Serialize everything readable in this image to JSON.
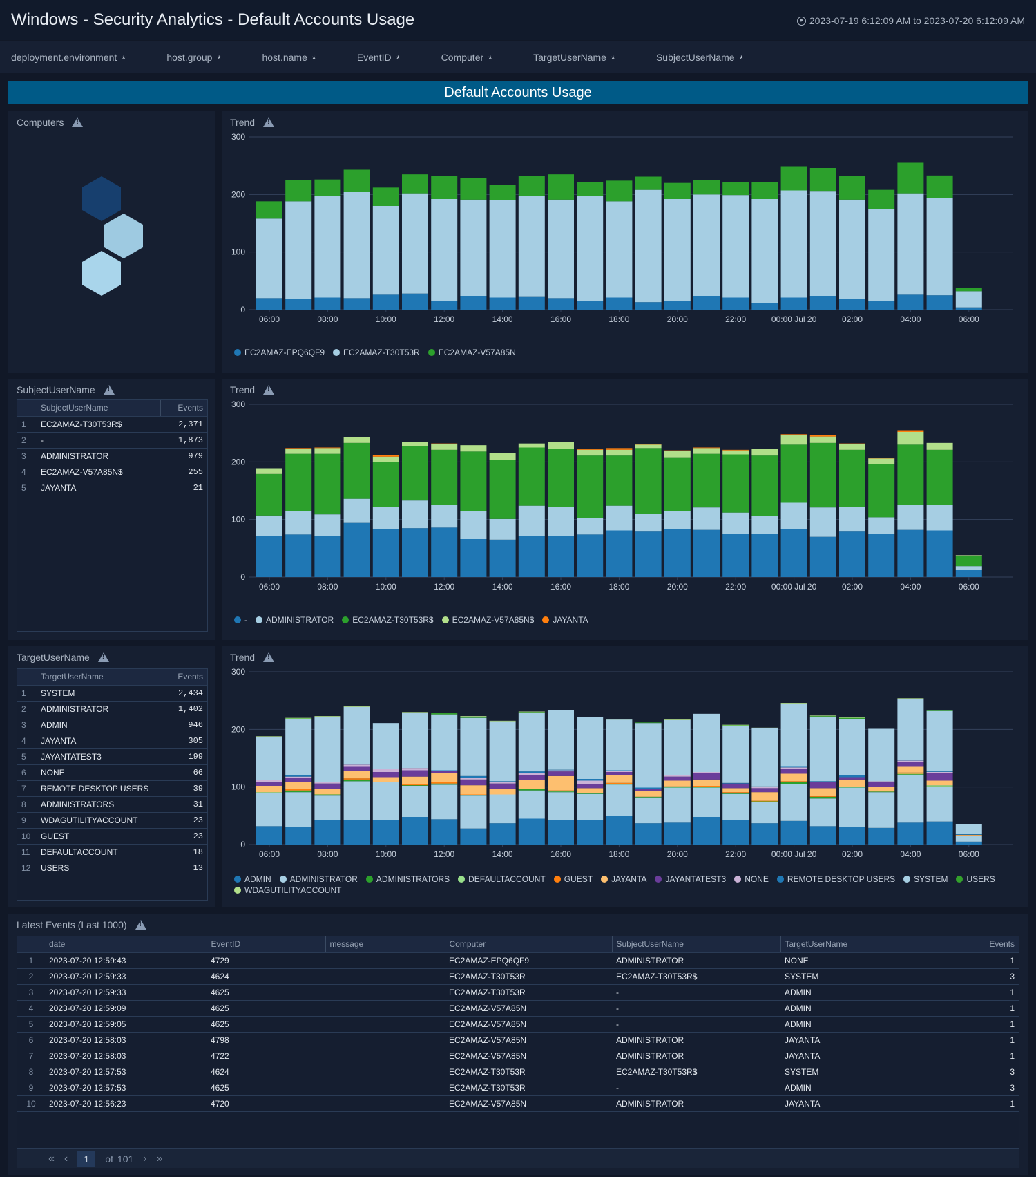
{
  "header": {
    "title": "Windows - Security Analytics - Default Accounts Usage",
    "time_range": "2023-07-19 6:12:09 AM to 2023-07-20 6:12:09 AM",
    "clock_icon": "clock-icon"
  },
  "filters": [
    {
      "label": "deployment.environment",
      "value": "*"
    },
    {
      "label": "host.group",
      "value": "*"
    },
    {
      "label": "host.name",
      "value": "*"
    },
    {
      "label": "EventID",
      "value": "*"
    },
    {
      "label": "Computer",
      "value": "*"
    },
    {
      "label": "TargetUserName",
      "value": "*"
    },
    {
      "label": "SubjectUserName",
      "value": "*"
    }
  ],
  "banner": "Default Accounts Usage",
  "computers_panel": {
    "title": "Computers",
    "hexagons": [
      {
        "name": "EC2AMAZ-EPQ6QF9",
        "color": "#173f6e"
      },
      {
        "name": "EC2AMAZ-T30T53R",
        "color": "#9ecae1"
      },
      {
        "name": "EC2AMAZ-V57A85N",
        "color": "#a9d5eb"
      }
    ]
  },
  "subject_panel": {
    "title": "SubjectUserName",
    "columns": [
      "SubjectUserName",
      "Events"
    ],
    "rows": [
      {
        "idx": "1",
        "name": "EC2AMAZ-T30T53R$",
        "events": "2,371"
      },
      {
        "idx": "2",
        "name": "-",
        "events": "1,873"
      },
      {
        "idx": "3",
        "name": "ADMINISTRATOR",
        "events": "979"
      },
      {
        "idx": "4",
        "name": "EC2AMAZ-V57A85N$",
        "events": "255"
      },
      {
        "idx": "5",
        "name": "JAYANTA",
        "events": "21"
      }
    ]
  },
  "target_panel": {
    "title": "TargetUserName",
    "columns": [
      "TargetUserName",
      "Events"
    ],
    "rows": [
      {
        "idx": "1",
        "name": "SYSTEM",
        "events": "2,434"
      },
      {
        "idx": "2",
        "name": "ADMINISTRATOR",
        "events": "1,402"
      },
      {
        "idx": "3",
        "name": "ADMIN",
        "events": "946"
      },
      {
        "idx": "4",
        "name": "JAYANTA",
        "events": "305"
      },
      {
        "idx": "5",
        "name": "JAYANTATEST3",
        "events": "199"
      },
      {
        "idx": "6",
        "name": "NONE",
        "events": "66"
      },
      {
        "idx": "7",
        "name": "REMOTE DESKTOP USERS",
        "events": "39"
      },
      {
        "idx": "8",
        "name": "ADMINISTRATORS",
        "events": "31"
      },
      {
        "idx": "9",
        "name": "WDAGUTILITYACCOUNT",
        "events": "23"
      },
      {
        "idx": "10",
        "name": "GUEST",
        "events": "23"
      },
      {
        "idx": "11",
        "name": "DEFAULTACCOUNT",
        "events": "18"
      },
      {
        "idx": "12",
        "name": "USERS",
        "events": "13"
      }
    ]
  },
  "events_panel": {
    "title": "Latest Events (Last 1000)",
    "columns": [
      "date",
      "EventID",
      "message",
      "Computer",
      "SubjectUserName",
      "TargetUserName",
      "Events"
    ],
    "rows": [
      {
        "idx": "1",
        "date": "2023-07-20 12:59:43",
        "eventid": "4729",
        "message": "",
        "computer": "EC2AMAZ-EPQ6QF9",
        "subject": "ADMINISTRATOR",
        "target": "NONE",
        "events": "1"
      },
      {
        "idx": "2",
        "date": "2023-07-20 12:59:33",
        "eventid": "4624",
        "message": "",
        "computer": "EC2AMAZ-T30T53R",
        "subject": "EC2AMAZ-T30T53R$",
        "target": "SYSTEM",
        "events": "3"
      },
      {
        "idx": "3",
        "date": "2023-07-20 12:59:33",
        "eventid": "4625",
        "message": "",
        "computer": "EC2AMAZ-T30T53R",
        "subject": "-",
        "target": "ADMIN",
        "events": "1"
      },
      {
        "idx": "4",
        "date": "2023-07-20 12:59:09",
        "eventid": "4625",
        "message": "",
        "computer": "EC2AMAZ-V57A85N",
        "subject": "-",
        "target": "ADMIN",
        "events": "1"
      },
      {
        "idx": "5",
        "date": "2023-07-20 12:59:05",
        "eventid": "4625",
        "message": "",
        "computer": "EC2AMAZ-V57A85N",
        "subject": "-",
        "target": "ADMIN",
        "events": "1"
      },
      {
        "idx": "6",
        "date": "2023-07-20 12:58:03",
        "eventid": "4798",
        "message": "",
        "computer": "EC2AMAZ-V57A85N",
        "subject": "ADMINISTRATOR",
        "target": "JAYANTA",
        "events": "1"
      },
      {
        "idx": "7",
        "date": "2023-07-20 12:58:03",
        "eventid": "4722",
        "message": "",
        "computer": "EC2AMAZ-V57A85N",
        "subject": "ADMINISTRATOR",
        "target": "JAYANTA",
        "events": "1"
      },
      {
        "idx": "8",
        "date": "2023-07-20 12:57:53",
        "eventid": "4624",
        "message": "",
        "computer": "EC2AMAZ-T30T53R",
        "subject": "EC2AMAZ-T30T53R$",
        "target": "SYSTEM",
        "events": "3"
      },
      {
        "idx": "9",
        "date": "2023-07-20 12:57:53",
        "eventid": "4625",
        "message": "",
        "computer": "EC2AMAZ-T30T53R",
        "subject": "-",
        "target": "ADMIN",
        "events": "3"
      },
      {
        "idx": "10",
        "date": "2023-07-20 12:56:23",
        "eventid": "4720",
        "message": "",
        "computer": "EC2AMAZ-V57A85N",
        "subject": "ADMINISTRATOR",
        "target": "JAYANTA",
        "events": "1"
      }
    ],
    "pager": {
      "current": "1",
      "of_label": "of",
      "total": "101"
    }
  },
  "chart_data": [
    {
      "type": "bar",
      "stacked": true,
      "title": "Trend",
      "panel": "computers",
      "xlabel": "",
      "ylabel": "",
      "ylim": [
        0,
        300
      ],
      "yticks": [
        0,
        100,
        200,
        300
      ],
      "grid": true,
      "legend": "bottom-left",
      "x_tick_labels": [
        "06:00",
        "08:00",
        "10:00",
        "12:00",
        "14:00",
        "16:00",
        "18:00",
        "20:00",
        "22:00",
        "00:00 Jul 20",
        "02:00",
        "04:00",
        "06:00"
      ],
      "series": [
        {
          "name": "EC2AMAZ-EPQ6QF9",
          "color": "#1f77b4",
          "values": [
            20,
            18,
            21,
            20,
            26,
            28,
            15,
            24,
            21,
            22,
            20,
            15,
            21,
            13,
            15,
            24,
            21,
            12,
            21,
            24,
            19,
            15,
            26,
            25,
            4
          ]
        },
        {
          "name": "EC2AMAZ-T30T53R",
          "color": "#a6cee3",
          "values": [
            138,
            170,
            176,
            184,
            154,
            174,
            177,
            167,
            169,
            175,
            171,
            183,
            167,
            195,
            177,
            176,
            178,
            180,
            186,
            181,
            172,
            160,
            176,
            169,
            28
          ]
        },
        {
          "name": "EC2AMAZ-V57A85N",
          "color": "#2ca02c",
          "values": [
            30,
            37,
            29,
            39,
            32,
            33,
            40,
            37,
            26,
            35,
            44,
            24,
            36,
            23,
            28,
            25,
            22,
            30,
            42,
            41,
            41,
            33,
            53,
            39,
            6
          ]
        }
      ]
    },
    {
      "type": "bar",
      "stacked": true,
      "title": "Trend",
      "panel": "subject",
      "xlabel": "",
      "ylabel": "",
      "ylim": [
        0,
        300
      ],
      "yticks": [
        0,
        100,
        200,
        300
      ],
      "grid": true,
      "legend": "bottom-left",
      "x_tick_labels": [
        "06:00",
        "08:00",
        "10:00",
        "12:00",
        "14:00",
        "16:00",
        "18:00",
        "20:00",
        "22:00",
        "00:00 Jul 20",
        "02:00",
        "04:00",
        "06:00"
      ],
      "series": [
        {
          "name": "-",
          "color": "#1f77b4",
          "values": [
            72,
            74,
            72,
            94,
            83,
            85,
            86,
            66,
            65,
            72,
            71,
            74,
            81,
            79,
            83,
            82,
            75,
            75,
            83,
            70,
            79,
            75,
            82,
            81,
            12
          ]
        },
        {
          "name": "ADMINISTRATOR",
          "color": "#a6cee3",
          "values": [
            35,
            41,
            37,
            42,
            39,
            48,
            39,
            49,
            36,
            52,
            51,
            29,
            43,
            31,
            31,
            39,
            37,
            31,
            46,
            51,
            43,
            29,
            43,
            44,
            7
          ]
        },
        {
          "name": "EC2AMAZ-T30T53R$",
          "color": "#2ca02c",
          "values": [
            72,
            99,
            105,
            97,
            78,
            94,
            96,
            103,
            102,
            101,
            101,
            108,
            87,
            114,
            94,
            93,
            101,
            105,
            101,
            112,
            99,
            92,
            105,
            96,
            18
          ]
        },
        {
          "name": "EC2AMAZ-V57A85N$",
          "color": "#b2df8a",
          "values": [
            10,
            9,
            10,
            10,
            9,
            7,
            10,
            11,
            12,
            7,
            11,
            10,
            10,
            6,
            11,
            10,
            7,
            11,
            16,
            11,
            10,
            10,
            22,
            12,
            1
          ]
        },
        {
          "name": "JAYANTA",
          "color": "#ff7f0e",
          "values": [
            0,
            1,
            1,
            0,
            3,
            0,
            1,
            0,
            1,
            0,
            0,
            1,
            3,
            1,
            1,
            1,
            1,
            0,
            2,
            2,
            1,
            1,
            3,
            0,
            0
          ]
        }
      ]
    },
    {
      "type": "bar",
      "stacked": true,
      "title": "Trend",
      "panel": "target",
      "xlabel": "",
      "ylabel": "",
      "ylim": [
        0,
        300
      ],
      "yticks": [
        0,
        100,
        200,
        300
      ],
      "grid": true,
      "legend": "bottom-left",
      "x_tick_labels": [
        "06:00",
        "08:00",
        "10:00",
        "12:00",
        "14:00",
        "16:00",
        "18:00",
        "20:00",
        "22:00",
        "00:00 Jul 20",
        "02:00",
        "04:00",
        "06:00"
      ],
      "series": [
        {
          "name": "ADMIN",
          "color": "#1f77b4",
          "values": [
            32,
            31,
            42,
            43,
            42,
            48,
            44,
            28,
            37,
            45,
            42,
            42,
            50,
            37,
            38,
            48,
            43,
            37,
            41,
            32,
            30,
            29,
            38,
            40,
            5
          ]
        },
        {
          "name": "ADMINISTRATOR",
          "color": "#a6cee3",
          "values": [
            58,
            60,
            43,
            67,
            66,
            54,
            60,
            57,
            50,
            49,
            49,
            46,
            54,
            45,
            61,
            51,
            45,
            37,
            64,
            48,
            69,
            62,
            82,
            60,
            10
          ]
        },
        {
          "name": "ADMINISTRATORS",
          "color": "#2ca02c",
          "values": [
            0,
            2,
            2,
            2,
            0,
            1,
            1,
            1,
            0,
            2,
            1,
            1,
            0,
            1,
            1,
            1,
            2,
            1,
            3,
            3,
            1,
            1,
            2,
            1,
            0
          ]
        },
        {
          "name": "DEFAULTACCOUNT",
          "color": "#98df8a",
          "values": [
            1,
            1,
            0,
            1,
            1,
            0,
            1,
            0,
            0,
            0,
            1,
            0,
            1,
            0,
            1,
            0,
            0,
            0,
            0,
            0,
            0,
            0,
            1,
            2,
            0
          ]
        },
        {
          "name": "GUEST",
          "color": "#ff7f0e",
          "values": [
            0,
            2,
            0,
            2,
            0,
            2,
            2,
            1,
            0,
            1,
            1,
            0,
            2,
            0,
            0,
            2,
            1,
            1,
            2,
            1,
            0,
            0,
            2,
            0,
            1
          ]
        },
        {
          "name": "JAYANTA",
          "color": "#fdbf6f",
          "values": [
            11,
            12,
            9,
            13,
            8,
            13,
            16,
            16,
            9,
            15,
            25,
            9,
            13,
            10,
            10,
            11,
            7,
            15,
            13,
            14,
            13,
            8,
            10,
            8,
            1
          ]
        },
        {
          "name": "JAYANTATEST3",
          "color": "#6a3d9a",
          "values": [
            7,
            8,
            10,
            7,
            9,
            11,
            4,
            10,
            10,
            8,
            8,
            7,
            6,
            3,
            7,
            11,
            8,
            7,
            8,
            10,
            4,
            8,
            9,
            13,
            0
          ]
        },
        {
          "name": "NONE",
          "color": "#cab2d6",
          "values": [
            3,
            2,
            3,
            4,
            5,
            4,
            0,
            3,
            3,
            4,
            2,
            6,
            2,
            1,
            2,
            2,
            0,
            3,
            3,
            0,
            0,
            2,
            2,
            2,
            0
          ]
        },
        {
          "name": "REMOTE DESKTOP USERS",
          "color": "#1f78b4",
          "values": [
            0,
            2,
            0,
            1,
            0,
            0,
            1,
            3,
            1,
            3,
            1,
            3,
            1,
            2,
            1,
            0,
            1,
            0,
            1,
            2,
            4,
            0,
            1,
            1,
            1
          ]
        },
        {
          "name": "SYSTEM",
          "color": "#a6cee3",
          "values": [
            75,
            98,
            112,
            99,
            80,
            96,
            97,
            101,
            104,
            102,
            104,
            108,
            88,
            112,
            95,
            101,
            99,
            101,
            110,
            111,
            97,
            91,
            105,
            105,
            18
          ]
        },
        {
          "name": "USERS",
          "color": "#33a02c",
          "values": [
            0,
            1,
            1,
            0,
            0,
            0,
            2,
            1,
            0,
            1,
            0,
            0,
            0,
            1,
            0,
            0,
            1,
            0,
            0,
            2,
            2,
            0,
            1,
            2,
            0
          ]
        },
        {
          "name": "WDAGUTILITYACCOUNT",
          "color": "#b2df8a",
          "values": [
            1,
            1,
            1,
            1,
            0,
            1,
            0,
            2,
            1,
            1,
            0,
            0,
            1,
            0,
            1,
            0,
            1,
            1,
            1,
            1,
            1,
            0,
            1,
            0,
            0
          ]
        }
      ]
    }
  ]
}
